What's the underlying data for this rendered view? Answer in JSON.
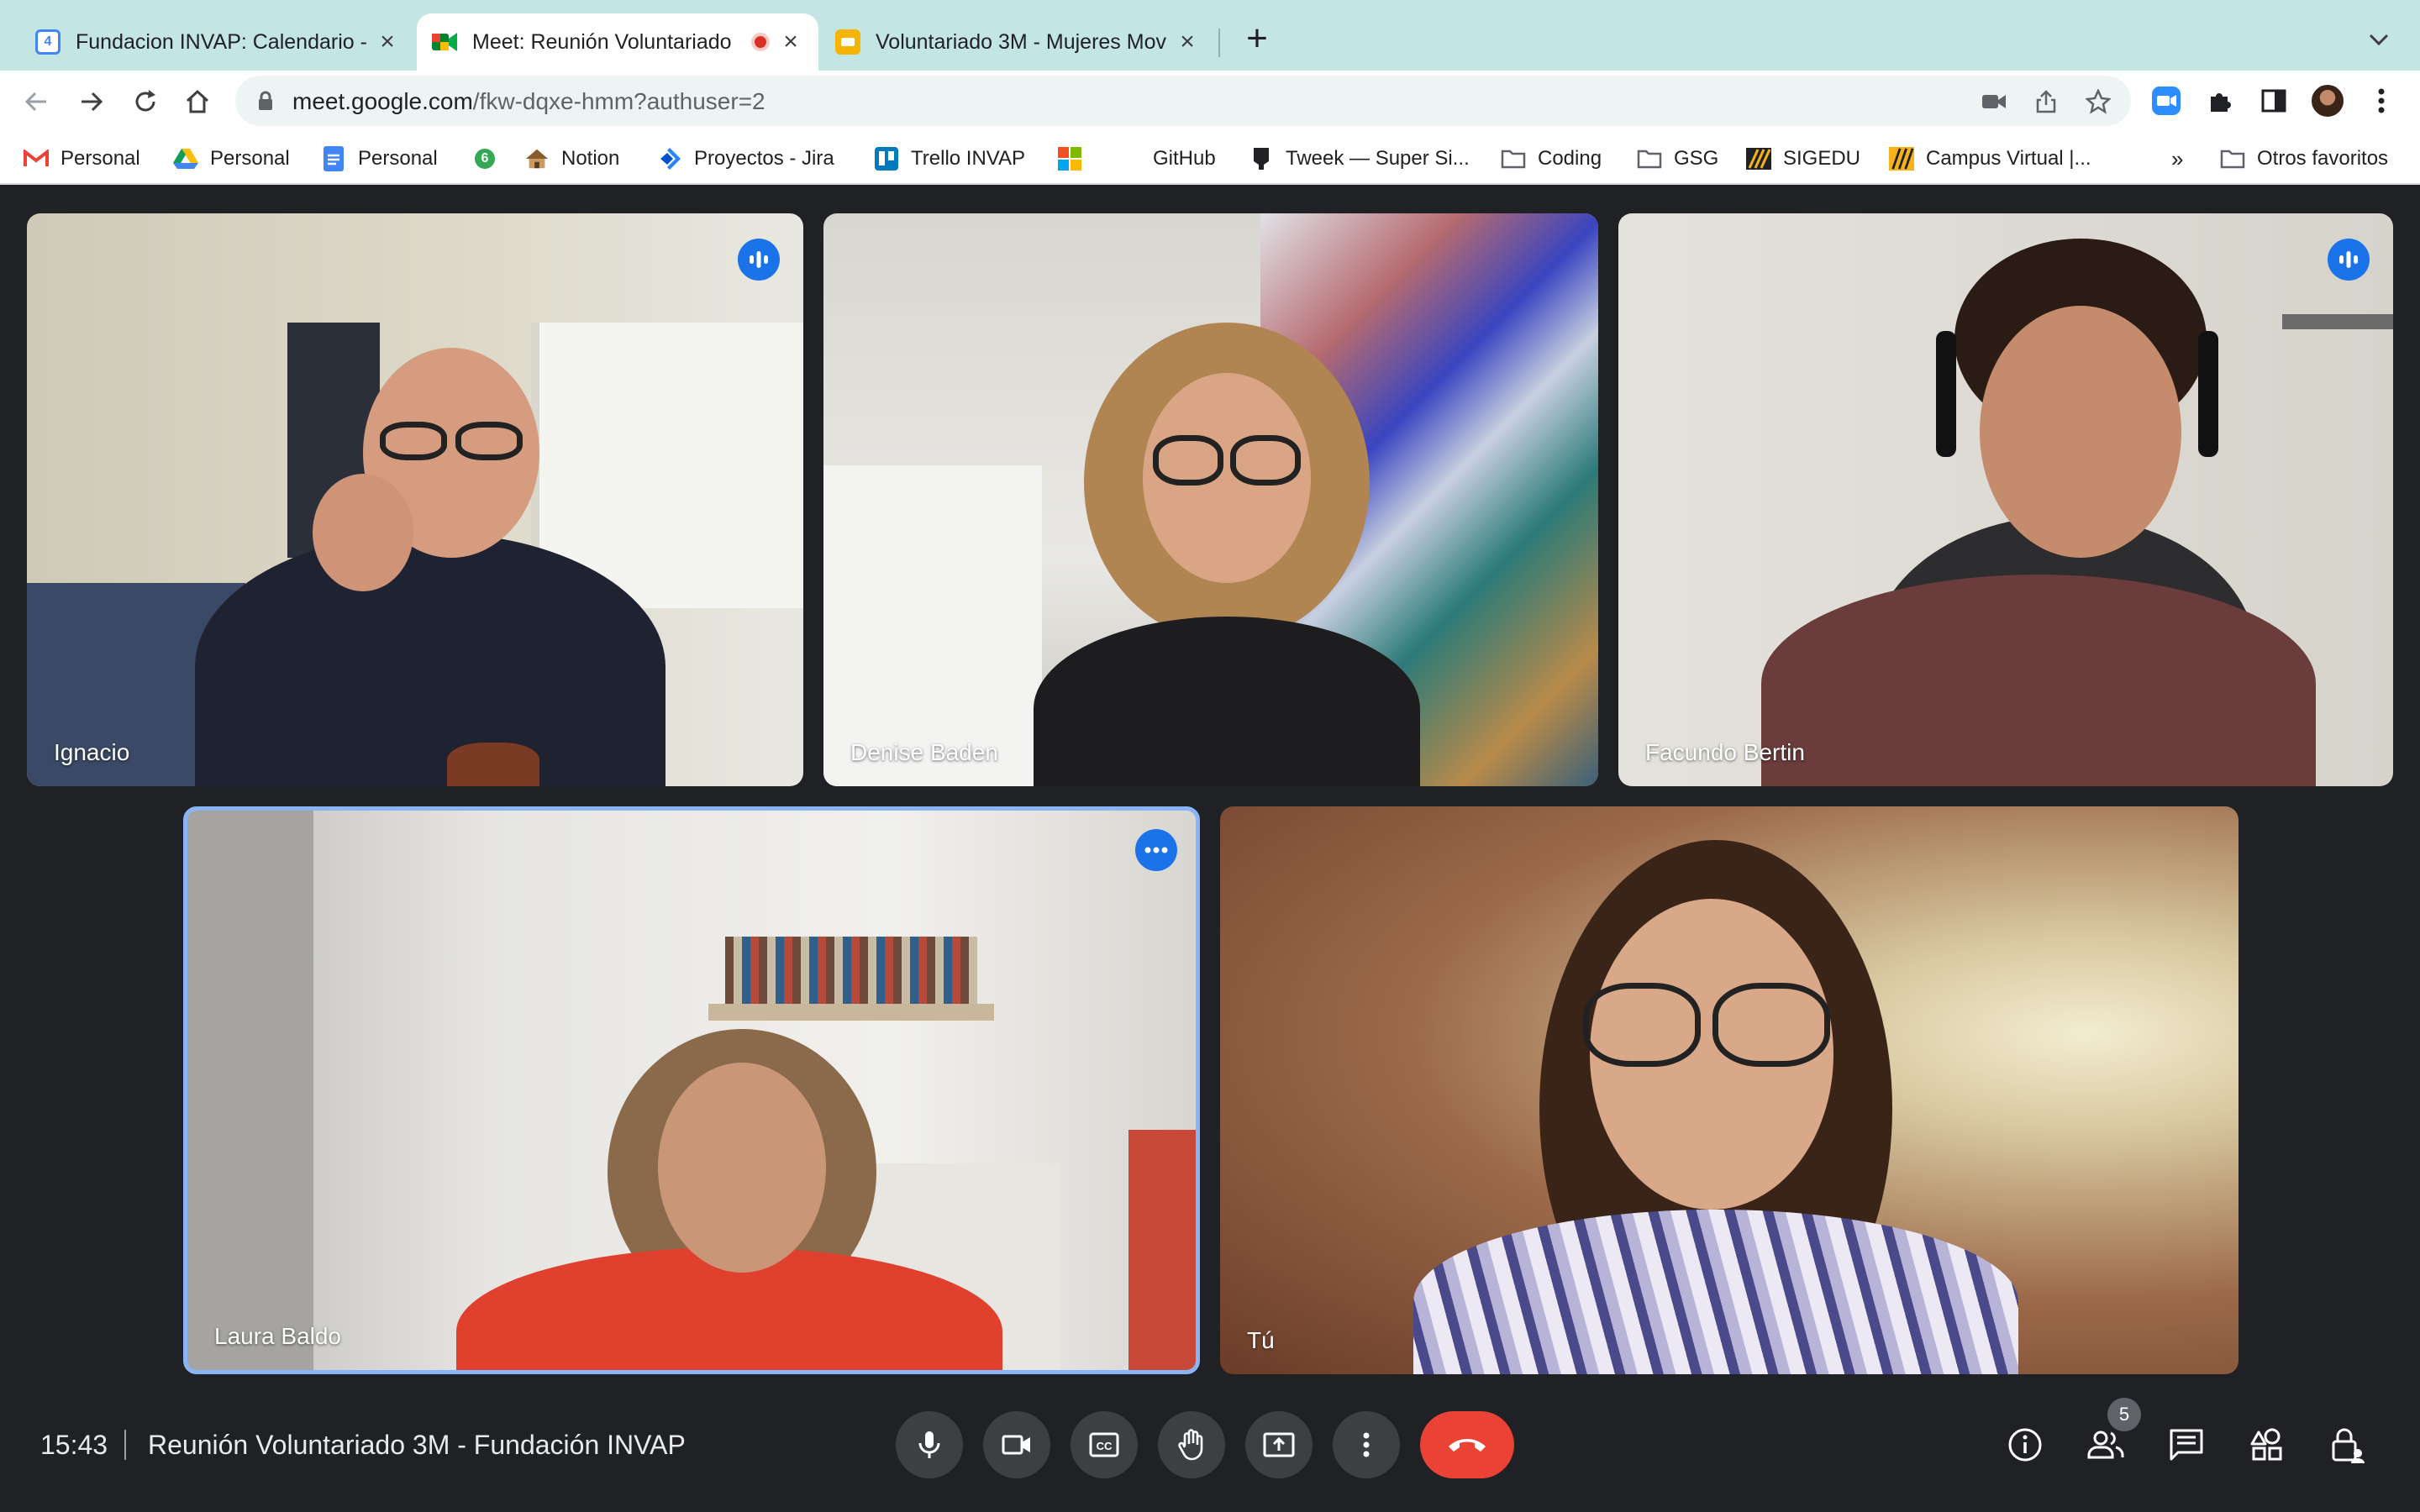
{
  "browser": {
    "tabs": [
      {
        "title": "Fundacion INVAP: Calendario -",
        "icon": "calendar-icon",
        "active": false
      },
      {
        "title": "Meet: Reunión Voluntariado",
        "icon": "meet-icon",
        "active": true,
        "recording": true
      },
      {
        "title": "Voluntariado 3M - Mujeres Mov",
        "icon": "slides-icon",
        "active": false
      }
    ],
    "url_host": "meet.google.com",
    "url_path": "/fkw-dqxe-hmm?authuser=2",
    "bookmarks": [
      {
        "label": "Personal",
        "icon": "gmail-icon"
      },
      {
        "label": "Personal",
        "icon": "drive-icon"
      },
      {
        "label": "Personal",
        "icon": "docs-icon"
      },
      {
        "label": "",
        "icon": "sheets-badge-icon"
      },
      {
        "label": "Notion",
        "icon": "notion-icon"
      },
      {
        "label": "Proyectos - Jira",
        "icon": "jira-icon"
      },
      {
        "label": "Trello INVAP",
        "icon": "trello-icon"
      },
      {
        "label": "",
        "icon": "microsoft-icon"
      },
      {
        "label": "GitHub",
        "icon": "github-icon"
      },
      {
        "label": "Tweek — Super Si...",
        "icon": "tweek-icon"
      },
      {
        "label": "Coding",
        "icon": "folder-icon"
      },
      {
        "label": "GSG",
        "icon": "folder-icon"
      },
      {
        "label": "SIGEDU",
        "icon": "sigedu-icon"
      },
      {
        "label": "Campus Virtual |...",
        "icon": "campus-icon"
      },
      {
        "label": "»",
        "icon": "overflow-chevron"
      },
      {
        "label": "Otros favoritos",
        "icon": "folder-icon"
      }
    ]
  },
  "participants": [
    {
      "name": "Ignacio",
      "indicator": "speaking"
    },
    {
      "name": "Denise Baden",
      "indicator": ""
    },
    {
      "name": "Facundo Bertin",
      "indicator": "speaking"
    },
    {
      "name": "Laura Baldo",
      "indicator": "more-options",
      "pinned": true
    },
    {
      "name": "Tú",
      "indicator": ""
    }
  ],
  "meeting": {
    "time": "15:43",
    "title": "Reunión Voluntariado 3M - Fundación INVAP",
    "participant_count": "5"
  },
  "colors": {
    "meet_blue": "#1a73e8",
    "hangup_red": "#ea4335",
    "control_gray": "#3c4043",
    "stage_bg": "#202124",
    "tabstrip": "#c3e5e3"
  }
}
